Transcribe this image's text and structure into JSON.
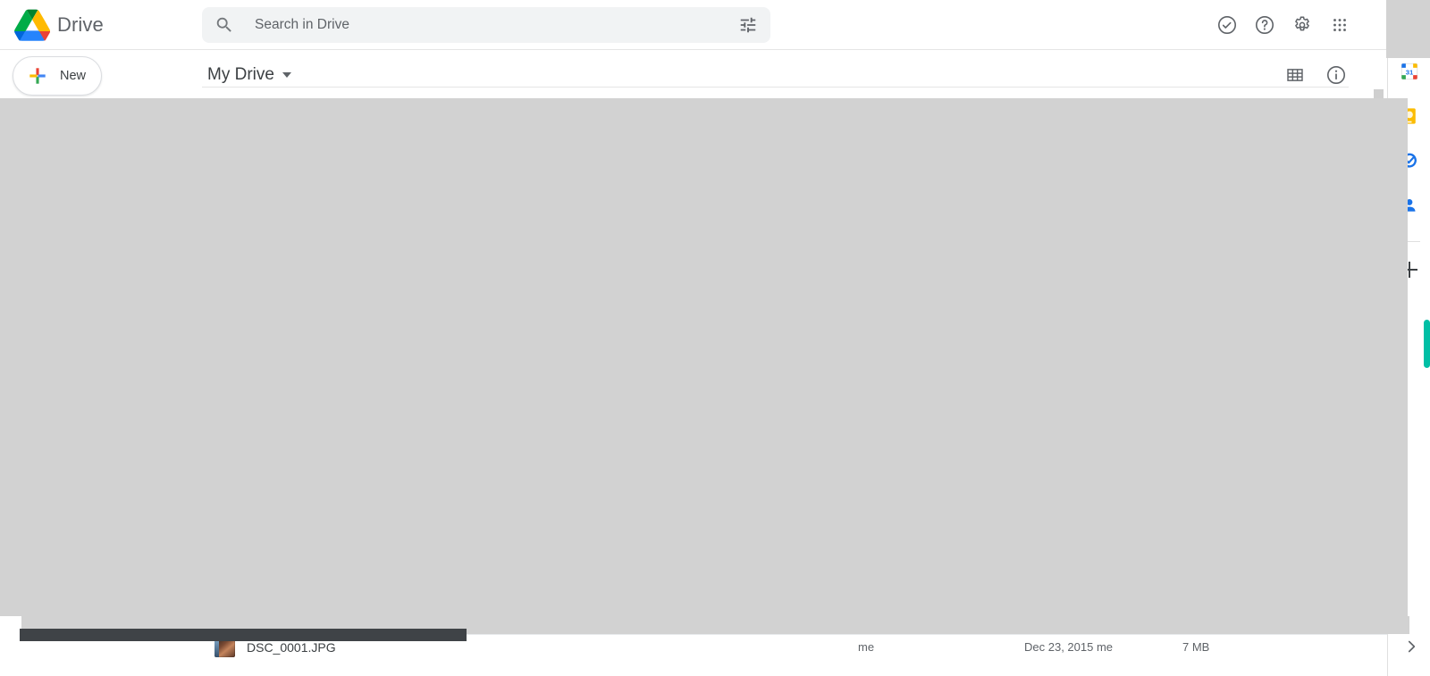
{
  "app": {
    "name": "Drive",
    "logo_icon": "google-drive-logo",
    "brand_colors": {
      "blue": "#1a73e8",
      "green": "#34a853",
      "yellow": "#fbbc04",
      "red": "#ea4335",
      "grey_text": "#5f6368",
      "dark_text": "#3c4043",
      "chrome_bg": "#ffffff",
      "search_bg": "#f1f3f4",
      "overlay_grey": "#d2d2d2",
      "scrollbar_dark": "#3f4347",
      "accent_teal": "#00bfa5"
    }
  },
  "search": {
    "placeholder": "Search in Drive",
    "value": "",
    "search_icon": "search-icon",
    "filter_icon": "tune-filter-icon"
  },
  "topbar": {
    "actions": [
      {
        "name": "support-button",
        "icon": "check-circle-icon",
        "label": "Support"
      },
      {
        "name": "help-button",
        "icon": "question-circle-icon",
        "label": "Help"
      },
      {
        "name": "settings-button",
        "icon": "gear-icon",
        "label": "Settings"
      },
      {
        "name": "google-apps-button",
        "icon": "apps-grid-icon",
        "label": "Google apps"
      }
    ]
  },
  "toolbar": {
    "new_label": "New",
    "new_icon": "plus-multicolor-icon",
    "breadcrumb": "My Drive",
    "breadcrumb_caret_icon": "chevron-down-icon",
    "view_toggle_icon": "grid-view-icon",
    "view_toggle_label": "Grid view",
    "details_icon": "info-circle-icon",
    "details_label": "View details"
  },
  "file_list": {
    "rows": [
      {
        "name": "DSC_0001.JPG",
        "thumbnail_icon": "photo-thumbnail",
        "owner": "me",
        "last_modified": "Dec 23, 2015 me",
        "size": "7 MB"
      }
    ]
  },
  "side_panel": {
    "apps": [
      {
        "name": "google-calendar-icon",
        "label": "Calendar",
        "badge": "31"
      },
      {
        "name": "google-keep-icon",
        "label": "Keep"
      },
      {
        "name": "google-tasks-icon",
        "label": "Tasks"
      },
      {
        "name": "google-contacts-icon",
        "label": "Contacts"
      }
    ],
    "add_label": "Get add-ons",
    "add_icon": "plus-icon",
    "expand_icon": "chevron-right-icon",
    "expand_label": "Show side panel"
  }
}
